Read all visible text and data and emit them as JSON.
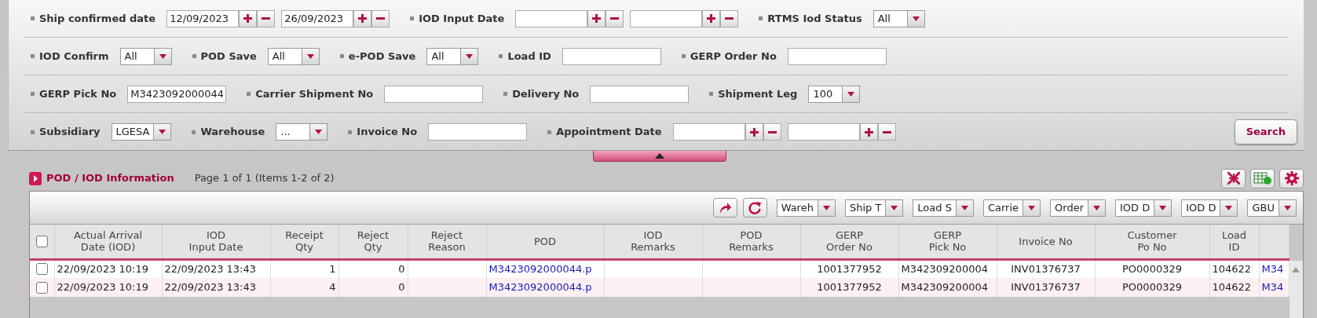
{
  "filter_rows": [
    [
      {
        "label": "Ship confirmed date",
        "kind": "date_range",
        "from": "12/09/2023",
        "to": "26/09/2023"
      },
      {
        "label": "IOD Input Date",
        "kind": "date_range"
      },
      {
        "label": "RTMS Iod Status",
        "kind": "select",
        "value": "All"
      }
    ],
    [
      {
        "label": "IOD Confirm",
        "kind": "select",
        "value": "All"
      },
      {
        "label": "POD Save",
        "kind": "select",
        "value": "All"
      },
      {
        "label": "e-POD Save",
        "kind": "select",
        "value": "All"
      },
      {
        "label": "Load ID",
        "kind": "text"
      },
      {
        "label": "GERP Order No",
        "kind": "text"
      }
    ],
    [
      {
        "label": "GERP Pick No",
        "kind": "text",
        "value": "M3423092000044"
      },
      {
        "label": "Carrier Shipment No",
        "kind": "text"
      },
      {
        "label": "Delivery No",
        "kind": "text"
      },
      {
        "label": "Shipment Leg",
        "kind": "select",
        "value": "100"
      }
    ],
    [
      {
        "label": "Subsidiary",
        "kind": "select",
        "value": "LGESA"
      },
      {
        "label": "Warehouse",
        "kind": "select",
        "value": "..."
      },
      {
        "label": "Invoice No",
        "kind": "text"
      },
      {
        "label": "Appointment Date",
        "kind": "date_range"
      }
    ]
  ],
  "search_button": "Search",
  "section": {
    "title": "POD / IOD Information",
    "paging": "Page 1 of 1 (Items 1-2 of 2)"
  },
  "column_filters": [
    "Wareh",
    "Ship T",
    "Load S",
    "Carrie",
    "Order",
    "IOD D",
    "IOD D",
    "GBU"
  ],
  "table": {
    "header_checked": false,
    "columns": [
      {
        "heading": "Actual Arrival\nDate (IOD)",
        "kind": "text"
      },
      {
        "heading": "IOD\nInput Date",
        "kind": "text"
      },
      {
        "heading": "Receipt\nQty",
        "kind": "number"
      },
      {
        "heading": "Reject\nQty",
        "kind": "number"
      },
      {
        "heading": "Reject\nReason",
        "kind": "text"
      },
      {
        "heading": "POD",
        "kind": "link"
      },
      {
        "heading": "IOD\nRemarks",
        "kind": "text"
      },
      {
        "heading": "POD\nRemarks",
        "kind": "text"
      },
      {
        "heading": "GERP\nOrder No",
        "kind": "center"
      },
      {
        "heading": "GERP\nPick No",
        "kind": "text"
      },
      {
        "heading": "Invoice No",
        "kind": "center"
      },
      {
        "heading": "Customer\nPo No",
        "kind": "center"
      },
      {
        "heading": "Load\nID",
        "kind": "text"
      },
      {
        "kind": "link"
      }
    ],
    "rows": [
      {
        "checked": false,
        "cells": [
          "22/09/2023 10:19",
          "22/09/2023 13:43",
          "1",
          "0",
          "",
          "M3423092000044.p",
          "",
          "",
          "1001377952",
          "M342309200004",
          "INV01376737",
          "PO0000329",
          "104622",
          "M34"
        ]
      },
      {
        "checked": false,
        "cells": [
          "22/09/2023 10:19",
          "22/09/2023 13:43",
          "4",
          "0",
          "",
          "M3423092000044.p",
          "",
          "",
          "1001377952",
          "M342309200004",
          "INV01376737",
          "PO0000329",
          "104622",
          "M34"
        ]
      }
    ]
  }
}
